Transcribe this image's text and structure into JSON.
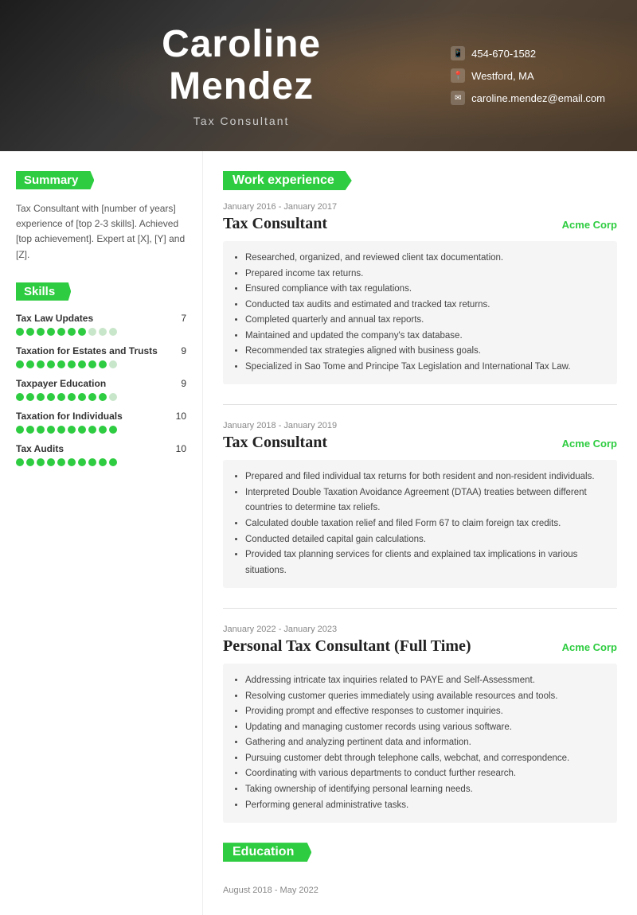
{
  "header": {
    "name_line1": "Caroline",
    "name_line2": "Mendez",
    "title": "Tax Consultant",
    "phone": "454-670-1582",
    "location": "Westford, MA",
    "email": "caroline.mendez@email.com"
  },
  "summary": {
    "section_label": "Summary",
    "text": "Tax Consultant with [number of years] experience of [top 2-3 skills]. Achieved [top achievement]. Expert at [X], [Y] and [Z]."
  },
  "skills": {
    "section_label": "Skills",
    "items": [
      {
        "name": "Tax Law Updates",
        "score": 7,
        "total": 10
      },
      {
        "name": "Taxation for Estates and Trusts",
        "score": 9,
        "total": 10
      },
      {
        "name": "Taxpayer Education",
        "score": 9,
        "total": 10
      },
      {
        "name": "Taxation for Individuals",
        "score": 10,
        "total": 10
      },
      {
        "name": "Tax Audits",
        "score": 10,
        "total": 10
      }
    ]
  },
  "work_experience": {
    "section_label": "Work experience",
    "jobs": [
      {
        "dates": "January 2016 - January 2017",
        "title": "Tax Consultant",
        "company": "Acme Corp",
        "bullets": [
          "Researched, organized, and reviewed client tax documentation.",
          "Prepared income tax returns.",
          "Ensured compliance with tax regulations.",
          "Conducted tax audits and estimated and tracked tax returns.",
          "Completed quarterly and annual tax reports.",
          "Maintained and updated the company's tax database.",
          "Recommended tax strategies aligned with business goals.",
          "Specialized in Sao Tome and Principe Tax Legislation and International Tax Law."
        ]
      },
      {
        "dates": "January 2018 - January 2019",
        "title": "Tax Consultant",
        "company": "Acme Corp",
        "bullets": [
          "Prepared and filed individual tax returns for both resident and non-resident individuals.",
          "Interpreted Double Taxation Avoidance Agreement (DTAA) treaties between different countries to determine tax reliefs.",
          "Calculated double taxation relief and filed Form 67 to claim foreign tax credits.",
          "Conducted detailed capital gain calculations.",
          "Provided tax planning services for clients and explained tax implications in various situations."
        ]
      },
      {
        "dates": "January 2022 - January 2023",
        "title": "Personal Tax Consultant (Full Time)",
        "company": "Acme Corp",
        "bullets": [
          "Addressing intricate tax inquiries related to PAYE and Self-Assessment.",
          "Resolving customer queries immediately using available resources and tools.",
          "Providing prompt and effective responses to customer inquiries.",
          "Updating and managing customer records using various software.",
          "Gathering and analyzing pertinent data and information.",
          "Pursuing customer debt through telephone calls, webchat, and correspondence.",
          "Coordinating with various departments to conduct further research.",
          "Taking ownership of identifying personal learning needs.",
          "Performing general administrative tasks."
        ]
      }
    ]
  },
  "education": {
    "section_label": "Education",
    "dates": "August 2018 - May 2022"
  }
}
